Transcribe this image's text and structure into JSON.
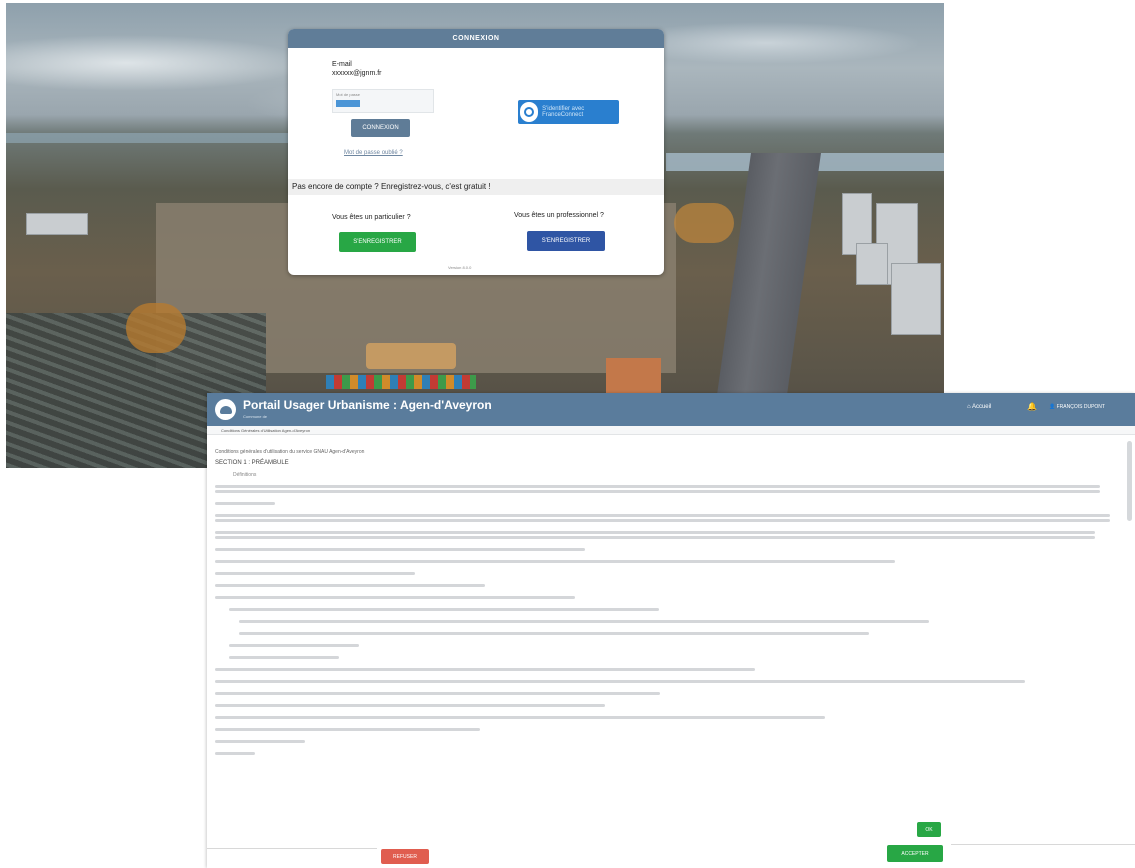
{
  "login": {
    "title": "CONNEXION",
    "identifier_label": "E-mail",
    "identifier_value": "xxxxxx@jgnm.fr",
    "password_placeholder": "Mot de passe",
    "connect_button": "CONNEXION",
    "forgot_link": "Mot de passe oublié ?",
    "franceconnect_button": "S'identifier avec FranceConnect",
    "signup_prompt": "Pas encore de compte ? Enregistrez-vous, c'est gratuit !",
    "particular_question": "Vous êtes un particulier ?",
    "professional_question": "Vous êtes un professionnel ?",
    "particular_button": "S'ENREGISTRER",
    "professional_button": "S'ENREGISTRER",
    "version": "Version 8.0.0"
  },
  "portal": {
    "title": "Portail Usager Urbanisme : Agen-d'Aveyron",
    "subtitle": "Commune de",
    "nav_home": "Accueil",
    "nav_user": "FRANÇOIS DUPONT",
    "breadcrumb": "Conditions Générales d'Utilisation Agen-d'Aveyron",
    "doc_intro": "Conditions générales d'utilisation du service GNAU Agen-d'Aveyron",
    "doc_section": "SECTION 1 : PRÉAMBULE",
    "doc_subsection": "Définitions",
    "ok_button": "OK",
    "cancel_button": "REFUSER",
    "submit_button": "ACCEPTER"
  },
  "colors": {
    "header_blue": "#5a7c9c",
    "login_header": "#607d98",
    "success_green": "#28a745",
    "pro_blue": "#2f55a4",
    "danger_red": "#e05d4f"
  }
}
